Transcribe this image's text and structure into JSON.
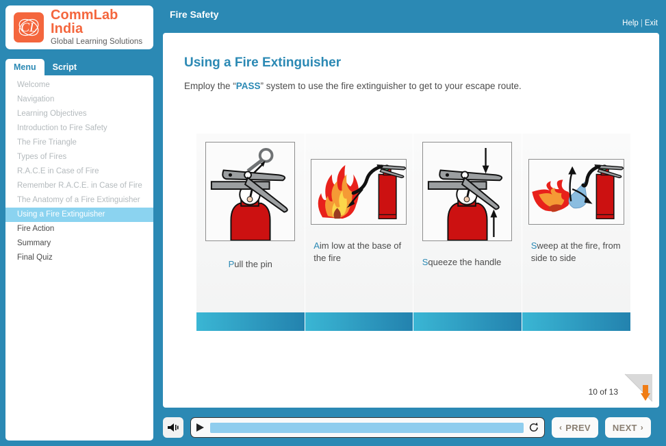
{
  "brand": {
    "logo_title": "CommLab India",
    "logo_subtitle": "Global Learning Solutions",
    "logo_mark_text": "CL",
    "accent_orange": "#f4663d",
    "accent_blue": "#2b89b4"
  },
  "header": {
    "course_title": "Fire Safety",
    "help_label": "Help",
    "separator": "|",
    "exit_label": "Exit"
  },
  "sidebar": {
    "tabs": [
      {
        "label": "Menu",
        "active": true
      },
      {
        "label": "Script",
        "active": false
      }
    ],
    "items": [
      {
        "label": "Welcome",
        "state": "visited"
      },
      {
        "label": "Navigation",
        "state": "visited"
      },
      {
        "label": "Learning Objectives",
        "state": "visited"
      },
      {
        "label": "Introduction to Fire Safety",
        "state": "visited"
      },
      {
        "label": "The Fire Triangle",
        "state": "visited"
      },
      {
        "label": "Types of Fires",
        "state": "visited"
      },
      {
        "label": "R.A.C.E in Case of Fire",
        "state": "visited"
      },
      {
        "label": "Remember R.A.C.E. in Case of Fire",
        "state": "visited"
      },
      {
        "label": "The Anatomy of a Fire Extinguisher",
        "state": "visited"
      },
      {
        "label": "Using a Fire Extinguisher",
        "state": "current"
      },
      {
        "label": "Fire Action",
        "state": "pending"
      },
      {
        "label": "Summary",
        "state": "pending"
      },
      {
        "label": "Final Quiz",
        "state": "pending"
      }
    ]
  },
  "slide": {
    "title": "Using a Fire Extinguisher",
    "subtitle_before": "Employ the “",
    "subtitle_highlight": "PASS",
    "subtitle_after": "” system to use the fire extinguisher to get to your escape route.",
    "cards": [
      {
        "initial": "P",
        "rest": "ull the pin",
        "figure": "extinguisher-pull-pin-illustration"
      },
      {
        "initial": "A",
        "rest": "im low at the base of the fire",
        "figure": "extinguisher-aim-at-fire-illustration"
      },
      {
        "initial": "S",
        "rest": "queeze the handle",
        "figure": "extinguisher-squeeze-handle-illustration"
      },
      {
        "initial": "S",
        "rest": "weep at the fire, from side to side",
        "figure": "extinguisher-sweep-fire-illustration"
      }
    ],
    "page_counter": "10 of 13"
  },
  "player": {
    "volume_icon": "speaker-icon",
    "play_icon": "play-icon",
    "replay_icon": "replay-icon",
    "progress_percent": 100,
    "prev_label": "PREV",
    "next_label": "NEXT",
    "prev_chevron": "‹",
    "next_chevron": "›"
  }
}
